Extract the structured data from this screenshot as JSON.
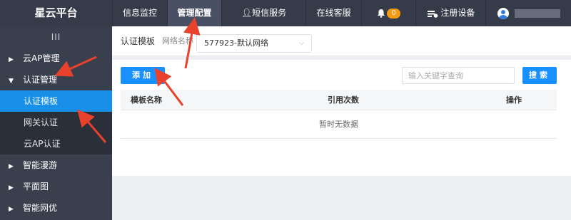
{
  "brand": "星云平台",
  "nav": {
    "info": "信息监控",
    "manage": "管理配置",
    "sms": "短信服务",
    "kf": "在线客服",
    "bell_count": "0",
    "register": "注册设备"
  },
  "sidebar": {
    "collapse": "III",
    "items": [
      {
        "label": "云AP管理",
        "arrow": "▶"
      },
      {
        "label": "认证管理",
        "arrow": "▼"
      },
      {
        "label": "智能漫游",
        "arrow": "▶"
      },
      {
        "label": "平面图",
        "arrow": "▶"
      },
      {
        "label": "智能网优",
        "arrow": "▶"
      }
    ],
    "subitems": [
      {
        "label": "认证模板"
      },
      {
        "label": "网关认证"
      },
      {
        "label": "云AP认证"
      }
    ]
  },
  "filter": {
    "title": "认证模板",
    "network_label": "网络名称",
    "network_value": "577923-默认网络"
  },
  "toolbar": {
    "add_label": "添加",
    "search_placeholder": "输入关键字查询",
    "search_label": "搜索"
  },
  "table": {
    "headers": [
      "模板名称",
      "引用次数",
      "操作"
    ],
    "empty_text": "暂时无数据"
  },
  "colors": {
    "topbar": "#363b49",
    "sidebar": "#3a3f4e",
    "accent": "#1890ff",
    "badge": "#f39c12",
    "annotation_arrow": "#e8412c"
  }
}
